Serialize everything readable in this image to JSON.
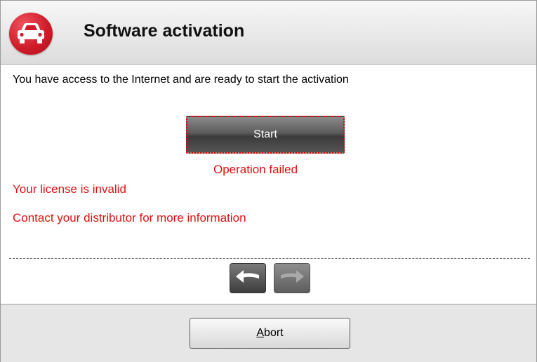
{
  "header": {
    "title": "Software activation",
    "icon": "car-icon",
    "icon_color": "#d01c2a"
  },
  "main": {
    "info_text": "You have access to the Internet and are ready to start the activation",
    "start_label": "Start",
    "status_text": "Operation failed",
    "error_lines": [
      "Your license is invalid",
      "Contact your distributor for more information"
    ],
    "error_color": "#e01010"
  },
  "navigation": {
    "back_icon": "arrow-back-icon",
    "forward_icon": "arrow-forward-icon"
  },
  "footer": {
    "abort_accel": "A",
    "abort_rest": "bort"
  }
}
